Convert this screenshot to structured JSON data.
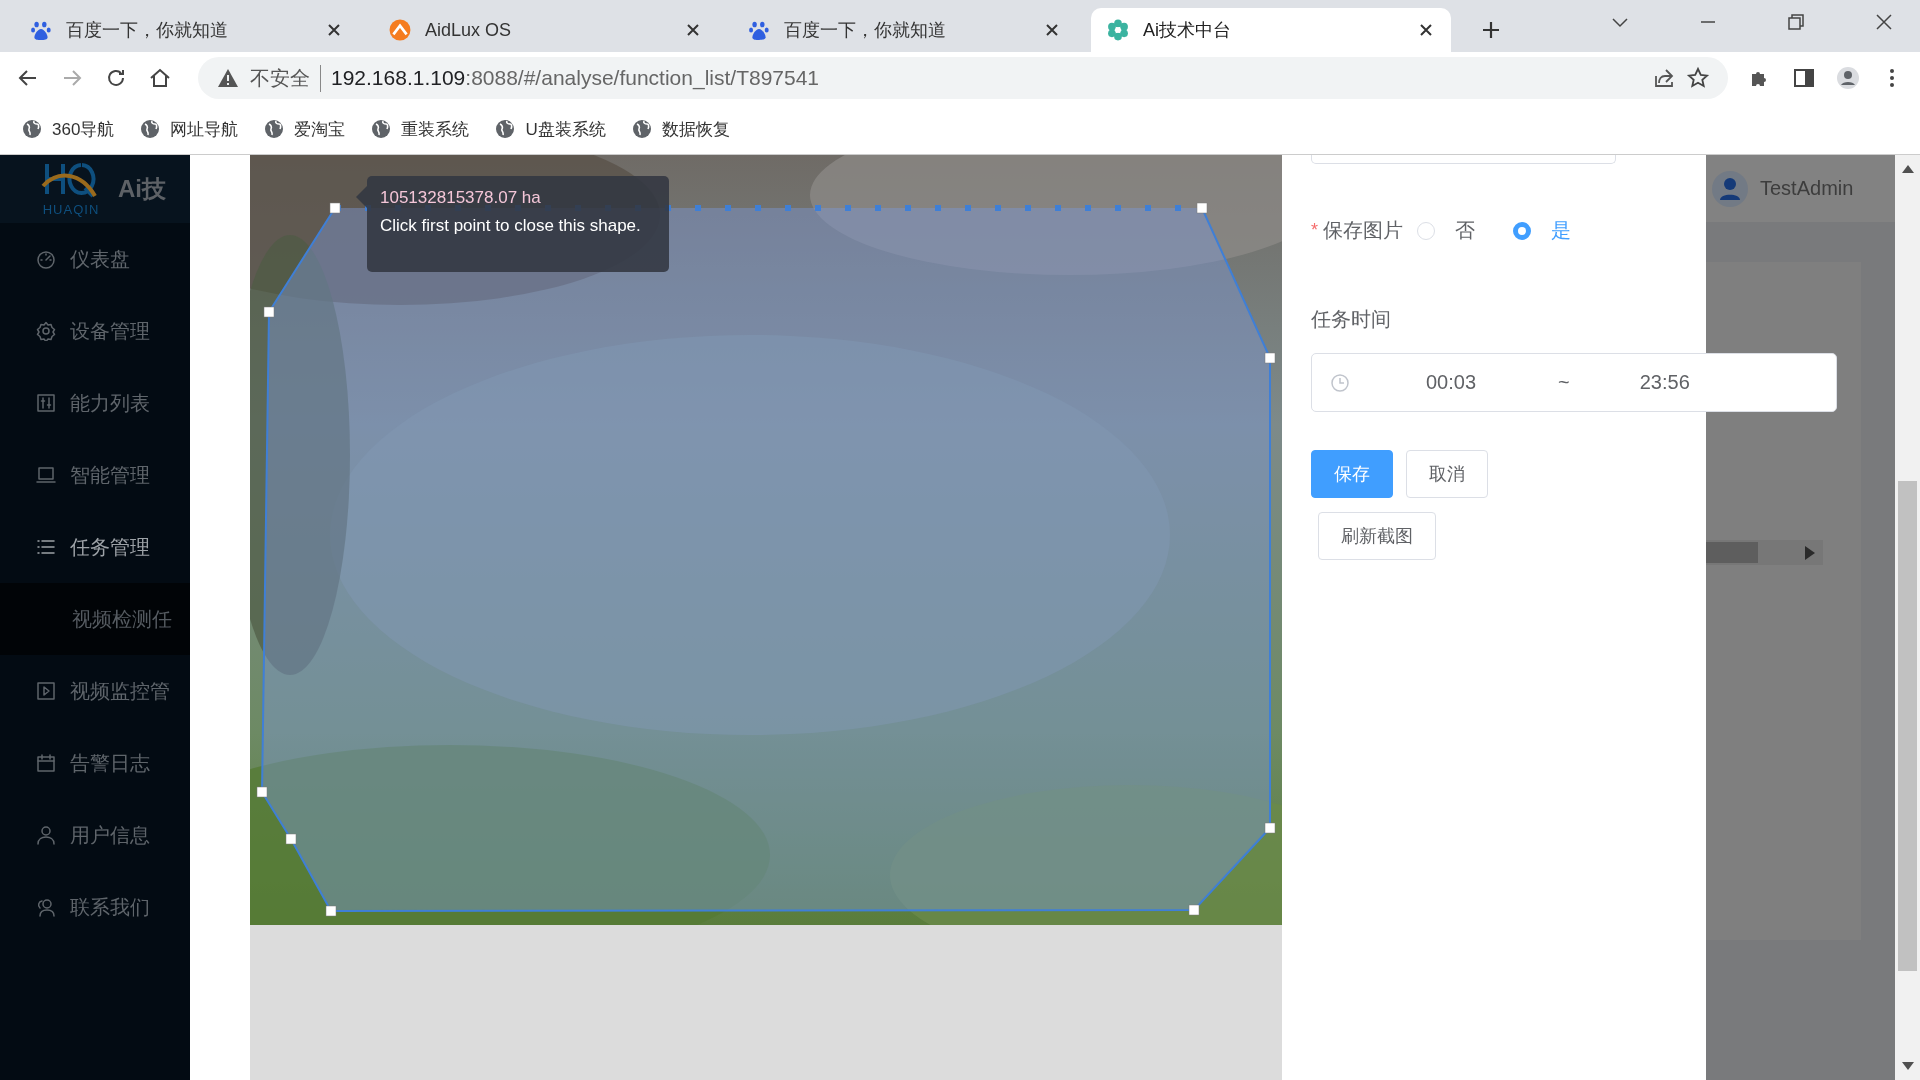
{
  "browser": {
    "tabs": [
      {
        "title": "百度一下，你就知道",
        "selected": false
      },
      {
        "title": "AidLux OS",
        "selected": false
      },
      {
        "title": "百度一下，你就知道",
        "selected": false
      },
      {
        "title": "Ai技术中台",
        "selected": true
      }
    ],
    "security": "不安全",
    "url_host": "192.168.1.109",
    "url_path": ":8088/#/analyse/function_list/T897541",
    "bookmarks": [
      "360导航",
      "网址导航",
      "爱淘宝",
      "重装系统",
      "U盘装系统",
      "数据恢复"
    ]
  },
  "sidebar": {
    "logo": "HUAQIN",
    "title": "Ai技",
    "items": [
      {
        "label": "仪表盘",
        "expanded": false
      },
      {
        "label": "设备管理",
        "expanded": false
      },
      {
        "label": "能力列表",
        "expanded": false
      },
      {
        "label": "智能管理",
        "expanded": false
      },
      {
        "label": "任务管理",
        "expanded": true,
        "children": [
          {
            "label": "视频检测任",
            "selected": true
          }
        ]
      },
      {
        "label": "视频监控管",
        "expanded": false
      },
      {
        "label": "告警日志",
        "expanded": false
      },
      {
        "label": "用户信息",
        "expanded": false
      },
      {
        "label": "联系我们",
        "expanded": false
      }
    ]
  },
  "header": {
    "user": "TestAdmin"
  },
  "editor": {
    "tooltip": {
      "measure": "105132815378.07 ha",
      "hint": "Click first point to close this shape."
    }
  },
  "form": {
    "save_image": {
      "label": "保存图片",
      "required_mark": "*",
      "options": [
        {
          "label": "否",
          "selected": false
        },
        {
          "label": "是",
          "selected": true
        }
      ]
    },
    "task_time": {
      "label": "任务时间",
      "start": "00:03",
      "separator": "~",
      "end": "23:56"
    },
    "buttons": [
      {
        "label": "保存",
        "kind": "primary"
      },
      {
        "label": "取消",
        "kind": "default"
      }
    ],
    "refresh_button": "刷新截图"
  }
}
